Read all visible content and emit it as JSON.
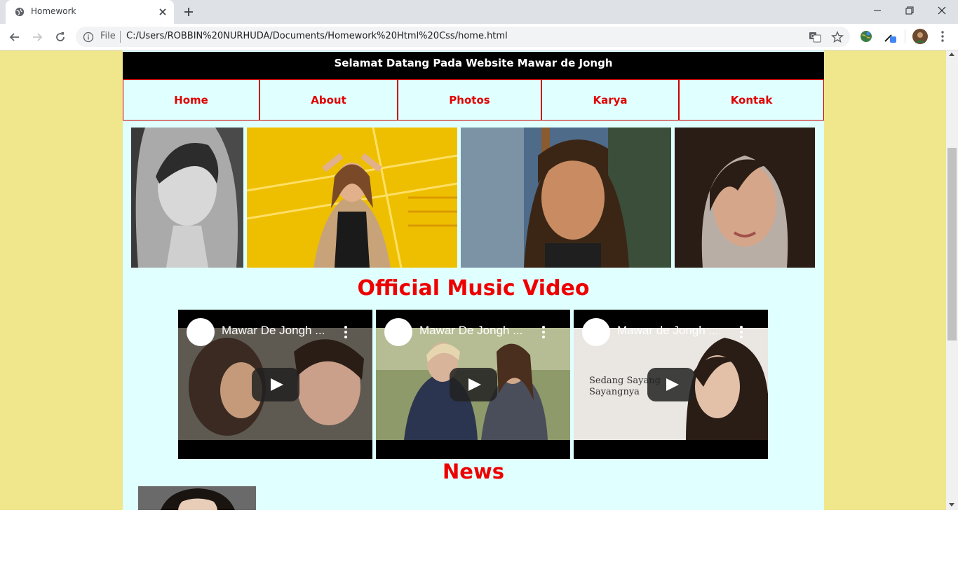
{
  "browser": {
    "tab_title": "Homework",
    "url_scheme": "File",
    "url": "C:/Users/ROBBIN%20NURHUDA/Documents/Homework%20Html%20Css/home.html"
  },
  "page": {
    "banner": "Selamat Datang Pada Website Mawar de Jongh",
    "nav": [
      "Home",
      "About",
      "Photos",
      "Karya",
      "Kontak"
    ],
    "music_heading": "Official Music Video",
    "videos": [
      {
        "title": "Mawar De Jongh ...",
        "overlay": ""
      },
      {
        "title": "Mawar De Jongh ...",
        "overlay": ""
      },
      {
        "title": "Mawar de Jongh ...",
        "overlay": "Sedang Sayang\nSayangnya"
      }
    ],
    "news_heading": "News"
  },
  "colors": {
    "page_bg": "#f0e68c",
    "content_bg": "#e0ffff",
    "accent_red": "#ee0000",
    "banner_bg": "#000000"
  }
}
